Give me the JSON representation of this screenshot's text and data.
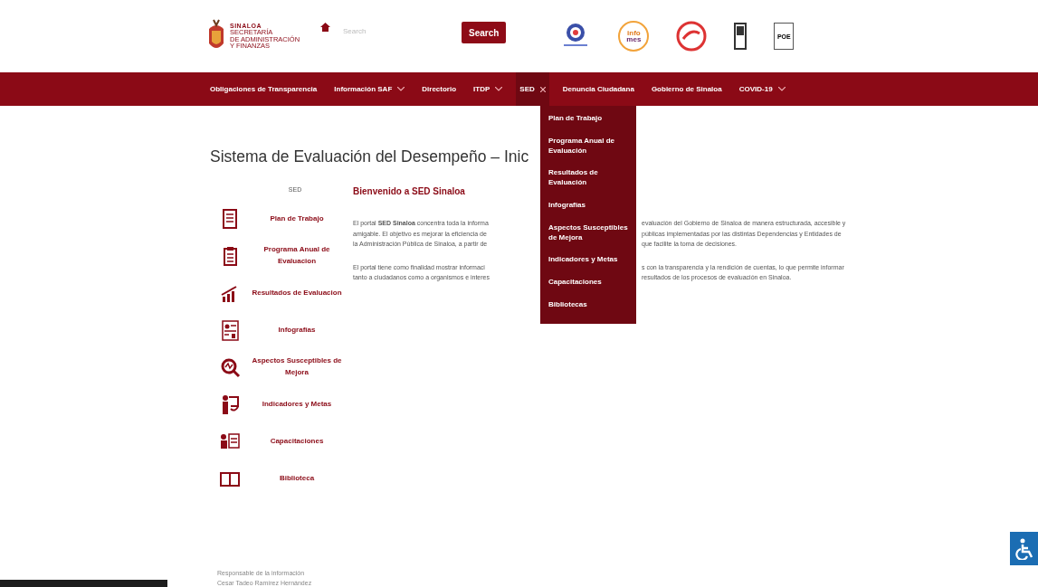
{
  "header": {
    "logo": {
      "name": "SINALOA",
      "subtitle": [
        "SECRETARÍA",
        "DE ADMINISTRACIÓN",
        "Y FINANZAS"
      ]
    },
    "search": {
      "placeholder": "Search"
    },
    "search_button": "Search",
    "partner_logos": [
      {
        "kind": "ring"
      },
      {
        "kind": "infomes",
        "text": [
          "info",
          "mes"
        ]
      },
      {
        "kind": "stamp"
      },
      {
        "kind": "device"
      },
      {
        "kind": "document",
        "text": "POE"
      }
    ]
  },
  "nav": {
    "items": [
      {
        "label": "Obligaciones de Transparencia",
        "has_menu": false,
        "expanded": false
      },
      {
        "label": "Información SAF",
        "has_menu": true,
        "expanded": false
      },
      {
        "label": "Directorio",
        "has_menu": false,
        "expanded": false
      },
      {
        "label": "ITDP",
        "has_menu": true,
        "expanded": false
      },
      {
        "label": "SED",
        "has_menu": true,
        "expanded": true
      },
      {
        "label": "Denuncia Ciudadana",
        "has_menu": false,
        "expanded": false
      },
      {
        "label": "Gobierno de Sinaloa",
        "has_menu": false,
        "expanded": false
      },
      {
        "label": "COVID-19",
        "has_menu": true,
        "expanded": false
      }
    ],
    "dropdown": [
      "Plan de Trabajo",
      "Programa Anual de Evaluación",
      "Resultados de Evaluación",
      "Infografías",
      "Aspectos Susceptibles de Mejora",
      "Indicadores y Metas",
      "Capacitaciones",
      "Bibliotecas"
    ]
  },
  "page": {
    "title": "Sistema de Evaluación del Desempeño – Inic",
    "sidebar": {
      "heading": "SED",
      "items": [
        {
          "label": "Plan de Trabajo",
          "kind": "document"
        },
        {
          "label": "Programa Anual de Evaluacion",
          "kind": "clipboard"
        },
        {
          "label": "Resultados de Evaluacion",
          "kind": "chart"
        },
        {
          "label": "Infografías",
          "kind": "infographic"
        },
        {
          "label": "Aspectos Susceptibles de Mejora",
          "kind": "magnifier"
        },
        {
          "label": "Indicadores y Metas",
          "kind": "presenter"
        },
        {
          "label": "Capacitaciones",
          "kind": "board"
        },
        {
          "label": "Biblioteca",
          "kind": "book"
        }
      ]
    },
    "welcome": "Bienvenido a SED Sinaloa",
    "paragraphs": [
      [
        {
          "left": "El portal **SED Sinaloa** concentra toda la informa",
          "right": "evaluación del Gobierno de Sinaloa de manera estructurada, accesible y"
        },
        {
          "left": "amigable. El objetivo es mejorar la eficiencia de",
          "right": "públicas implementadas por las distintas Dependencias y Entidades de"
        },
        {
          "left": "la Administración Pública de Sinaloa, a partir de",
          "right": "que facilite la toma de decisiones."
        }
      ],
      [
        {
          "left": "El portal tiene como finalidad mostrar informaci",
          "right": "s con la transparencia y la rendición de cuentas, lo que permite informar"
        },
        {
          "left": "tanto a ciudadanos como a organismos e interes",
          "right": "resultados de los procesos de evaluación en Sinaloa."
        }
      ]
    ],
    "footer": [
      "Responsable de la información",
      "Cesar Tadeo Ramírez Hernández"
    ]
  }
}
